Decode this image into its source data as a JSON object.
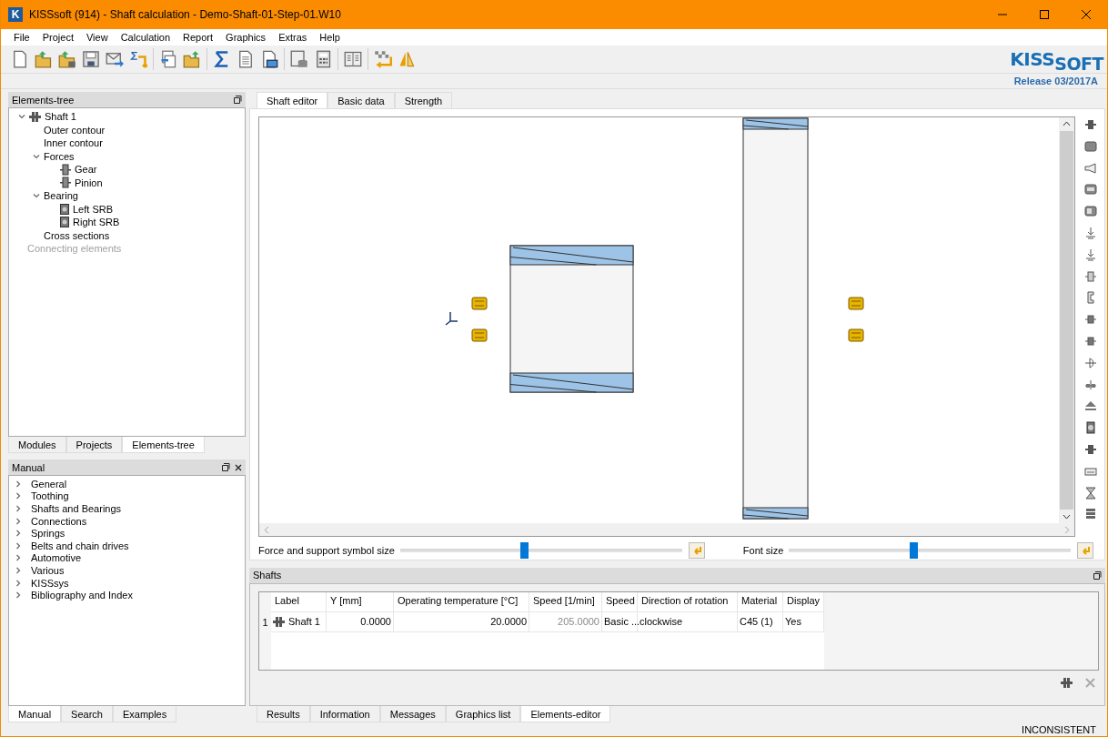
{
  "window": {
    "title": "KISSsoft (914) - Shaft calculation - Demo-Shaft-01-Step-01.W10",
    "logo_letter": "K"
  },
  "menu": [
    "File",
    "Project",
    "View",
    "Calculation",
    "Report",
    "Graphics",
    "Extras",
    "Help"
  ],
  "brand": {
    "logo_main": "KISS",
    "logo_sub": "SOFT",
    "release": "Release 03/2017A"
  },
  "elements_panel": {
    "title": "Elements-tree",
    "tree": [
      {
        "label": "Shaft 1",
        "kind": "shaft",
        "expanded": true,
        "disabled": false,
        "children": [
          {
            "label": "Outer contour",
            "disabled": false
          },
          {
            "label": "Inner contour",
            "disabled": false
          },
          {
            "label": "Forces",
            "expanded": true,
            "disabled": false,
            "children": [
              {
                "label": "Gear",
                "kind": "force",
                "disabled": false
              },
              {
                "label": "Pinion",
                "kind": "force",
                "disabled": false
              }
            ]
          },
          {
            "label": "Bearing",
            "expanded": true,
            "disabled": false,
            "children": [
              {
                "label": "Left SRB",
                "kind": "bearing",
                "disabled": false
              },
              {
                "label": "Right SRB",
                "kind": "bearing",
                "disabled": false
              }
            ]
          },
          {
            "label": "Cross sections",
            "disabled": false
          }
        ]
      },
      {
        "label": "Connecting elements",
        "disabled": true
      }
    ]
  },
  "left_tabs": [
    {
      "label": "Modules",
      "selected": false
    },
    {
      "label": "Projects",
      "selected": false
    },
    {
      "label": "Elements-tree",
      "selected": true
    }
  ],
  "manual_panel": {
    "title": "Manual",
    "items": [
      {
        "label": "General",
        "expanded": false
      },
      {
        "label": "Toothing",
        "expanded": false
      },
      {
        "label": "Shafts and Bearings",
        "expanded": false
      },
      {
        "label": "Connections",
        "expanded": false
      },
      {
        "label": "Springs",
        "expanded": false
      },
      {
        "label": "Belts and chain drives",
        "expanded": false
      },
      {
        "label": "Automotive",
        "expanded": false
      },
      {
        "label": "Various",
        "expanded": false
      },
      {
        "label": "KISSsys",
        "expanded": false
      },
      {
        "label": "Bibliography and Index",
        "expanded": false
      }
    ]
  },
  "manual_tabs": [
    {
      "label": "Manual",
      "selected": true
    },
    {
      "label": "Search",
      "selected": false
    },
    {
      "label": "Examples",
      "selected": false
    }
  ],
  "editor_tabs": [
    {
      "label": "Shaft editor",
      "selected": true
    },
    {
      "label": "Basic data",
      "selected": false
    },
    {
      "label": "Strength",
      "selected": false
    }
  ],
  "sliders": [
    {
      "label": "Force and support symbol size",
      "level": 0.44
    },
    {
      "label": "Font size",
      "level": 0.44
    }
  ],
  "shafts_panel": {
    "title": "Shafts",
    "columns": [
      "Label",
      "Y [mm]",
      "Operating temperature [°C]",
      "Speed [1/min]",
      "Speed",
      "Direction of rotation",
      "Material",
      "Display"
    ],
    "rows": [
      {
        "index": "1",
        "cells": [
          {
            "text": "Shaft 1",
            "kind": "shaft",
            "disabled": false
          },
          {
            "text": "0.0000",
            "kind": "number",
            "disabled": false
          },
          {
            "text": "20.0000",
            "kind": "number",
            "disabled": false
          },
          {
            "text": "205.0000",
            "kind": "number",
            "disabled": true
          },
          {
            "text": "Basic ...",
            "kind": "text",
            "disabled": false
          },
          {
            "text": "clockwise",
            "kind": "text",
            "disabled": false
          },
          {
            "text": "C45 (1)",
            "kind": "text",
            "disabled": false
          },
          {
            "text": "Yes",
            "kind": "text",
            "disabled": false
          }
        ]
      }
    ]
  },
  "bottom_tabs": [
    {
      "label": "Results",
      "selected": false
    },
    {
      "label": "Information",
      "selected": false
    },
    {
      "label": "Messages",
      "selected": false
    },
    {
      "label": "Graphics list",
      "selected": false
    },
    {
      "label": "Elements-editor",
      "selected": true
    }
  ],
  "status": "INCONSISTENT"
}
